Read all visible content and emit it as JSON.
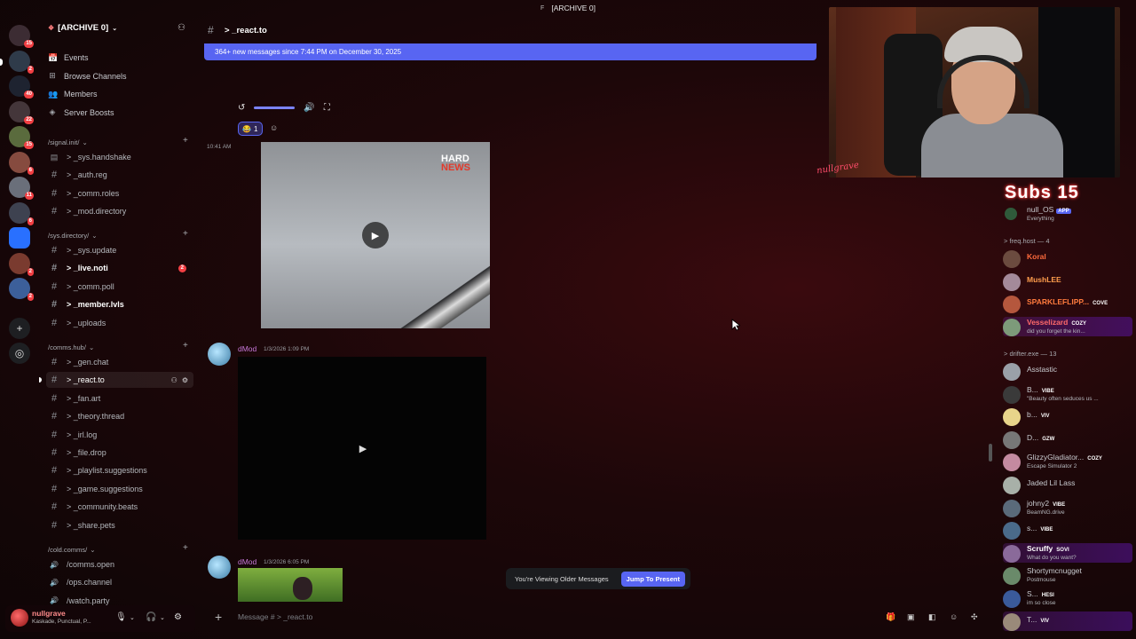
{
  "titlebar": {
    "icon": "F",
    "title": "[ARCHIVE 0]"
  },
  "rail": {
    "servers": [
      {
        "badge": "15",
        "color": "#3c2c33"
      },
      {
        "badge": "2",
        "color": "#2f3b4a"
      },
      {
        "badge": "40",
        "color": "#1e2330"
      },
      {
        "badge": "22",
        "color": "#44363a"
      },
      {
        "badge": "15",
        "color": "#5a6b3d"
      },
      {
        "badge": "6",
        "color": "#864b3f"
      },
      {
        "badge": "11",
        "color": "#6a6f7a"
      },
      {
        "badge": "6",
        "color": "#3e4250"
      },
      {
        "badge": "",
        "color": "#2970ff"
      },
      {
        "badge": "2",
        "color": "#7a3b2f"
      },
      {
        "badge": "2",
        "color": "#3c5f9a"
      }
    ]
  },
  "sidebar": {
    "server_name": "[ARCHIVE 0]",
    "nav": [
      {
        "icon": "calendar-icon",
        "label": "Events"
      },
      {
        "icon": "browse-channels-icon",
        "label": "Browse Channels"
      },
      {
        "icon": "members-icon",
        "label": "Members"
      },
      {
        "icon": "boost-icon",
        "label": "Server Boosts"
      }
    ],
    "categories": [
      {
        "name": "/signal.init/",
        "channels": [
          {
            "label": "> _sys.handshake",
            "type": "rules"
          },
          {
            "label": "> _auth.reg",
            "type": "text"
          },
          {
            "label": "> _comm.roles",
            "type": "text"
          },
          {
            "label": "> _mod.directory",
            "type": "text"
          }
        ]
      },
      {
        "name": "/sys.directory/",
        "channels": [
          {
            "label": "> _sys.update",
            "type": "text"
          },
          {
            "label": "> _live.noti",
            "type": "text",
            "unread": true,
            "badge": "2"
          },
          {
            "label": "> _comm.poll",
            "type": "text"
          },
          {
            "label": "> _member.lvls",
            "type": "text",
            "unread": true
          },
          {
            "label": "> _uploads",
            "type": "text"
          }
        ]
      },
      {
        "name": "/comms.hub/",
        "channels": [
          {
            "label": "> _gen.chat",
            "type": "text"
          },
          {
            "label": "> _react.to",
            "type": "text",
            "active": true
          },
          {
            "label": "> _fan.art",
            "type": "text"
          },
          {
            "label": "> _theory.thread",
            "type": "text"
          },
          {
            "label": "> _irl.log",
            "type": "text"
          },
          {
            "label": "> _file.drop",
            "type": "text"
          },
          {
            "label": "> _playlist.suggestions",
            "type": "text"
          },
          {
            "label": "> _game.suggestions",
            "type": "text"
          },
          {
            "label": "> _community.beats",
            "type": "text"
          },
          {
            "label": "> _share.pets",
            "type": "text"
          }
        ]
      },
      {
        "name": "/cold.comms/",
        "channels": [
          {
            "label": "/comms.open",
            "type": "voice"
          },
          {
            "label": "/ops.channel",
            "type": "voice"
          },
          {
            "label": "/watch.party",
            "type": "voice"
          }
        ]
      }
    ]
  },
  "user": {
    "name": "nullgrave",
    "status": "Kaskade, Punctual, P..."
  },
  "chat": {
    "channel_title": "> _react.to",
    "new_banner": "364+ new messages since 7:44 PM on December 30, 2025",
    "reaction_count": "1",
    "msg1_time": "10:41 AM",
    "video1_logo_line1": "HARD",
    "video1_logo_line2": "NEWS",
    "msg2_author": "dMod",
    "msg2_date": "1/3/2026 1:09 PM",
    "msg3_author": "dMod",
    "msg3_date": "1/3/2026 6:05 PM",
    "older_text": "You're Viewing Older Messages",
    "jump_label": "Jump To Present",
    "input_placeholder": "Message # > _react.to"
  },
  "overlay": {
    "signature": "nullgrave",
    "subs_label": "Subs 15"
  },
  "members": {
    "top": {
      "name": "null_OS",
      "tag": "APP",
      "activity": "Everything"
    },
    "groups": [
      {
        "title": "> freq.host — 4",
        "members": [
          {
            "name": "Koral",
            "color": "#ff6a3d",
            "avatar": "#6b4b3f"
          },
          {
            "name": "MushLEE",
            "color": "#ff9d4d",
            "avatar": "#a48a9a"
          },
          {
            "name": "SPARKLEFLIPP...",
            "color": "#ff7a3d",
            "avatar": "#b5573d",
            "tag": "COVE"
          },
          {
            "name": "Vesselizard",
            "color": "#ff6a6a",
            "avatar": "#7d9a7a",
            "tag": "COZY",
            "activity": "did you forget the kin...",
            "highlight": true
          }
        ]
      },
      {
        "title": "> drifter.exe — 13",
        "members": [
          {
            "name": "Asstastic",
            "color": "#c9cbd0",
            "avatar": "#9aa0a8"
          },
          {
            "name": "B...",
            "color": "#c9cbd0",
            "avatar": "#3a3a3a",
            "tag": "VIBE",
            "activity": "\"Beauty often seduces us ..."
          },
          {
            "name": "b...",
            "color": "#c9cbd0",
            "avatar": "#e8d48a",
            "tag": "VIV"
          },
          {
            "name": "D...",
            "color": "#c9cbd0",
            "avatar": "#777",
            "tag": "GZW"
          },
          {
            "name": "GlizzyGladiator...",
            "color": "#c9cbd0",
            "avatar": "#c48aa0",
            "tag": "COZY",
            "activity": "Escape Simulator 2"
          },
          {
            "name": "Jaded Lil Lass",
            "color": "#c9cbd0",
            "avatar": "#a8b0a8"
          },
          {
            "name": "johny2",
            "color": "#c9cbd0",
            "avatar": "#5a6a7a",
            "tag": "VIBE",
            "activity": "BeamNG.drive"
          },
          {
            "name": "s...",
            "color": "#c9cbd0",
            "avatar": "#4a6a8a",
            "tag": "VIBE"
          },
          {
            "name": "Scruffy",
            "color": "#ffffff",
            "avatar": "#8a6a9a",
            "tag": "SOVI",
            "activity": "What do you want?",
            "highlight": true
          },
          {
            "name": "Shortymcnugget",
            "color": "#c9cbd0",
            "avatar": "#6a8a6a",
            "activity": "Postmouse"
          },
          {
            "name": "S...",
            "color": "#c9cbd0",
            "avatar": "#3a5a9a",
            "tag": "HESI",
            "activity": "im so close"
          },
          {
            "name": "T...",
            "color": "#c9cbd0",
            "avatar": "#9a8a7a",
            "tag": "VIV",
            "highlight": true
          }
        ]
      }
    ]
  }
}
